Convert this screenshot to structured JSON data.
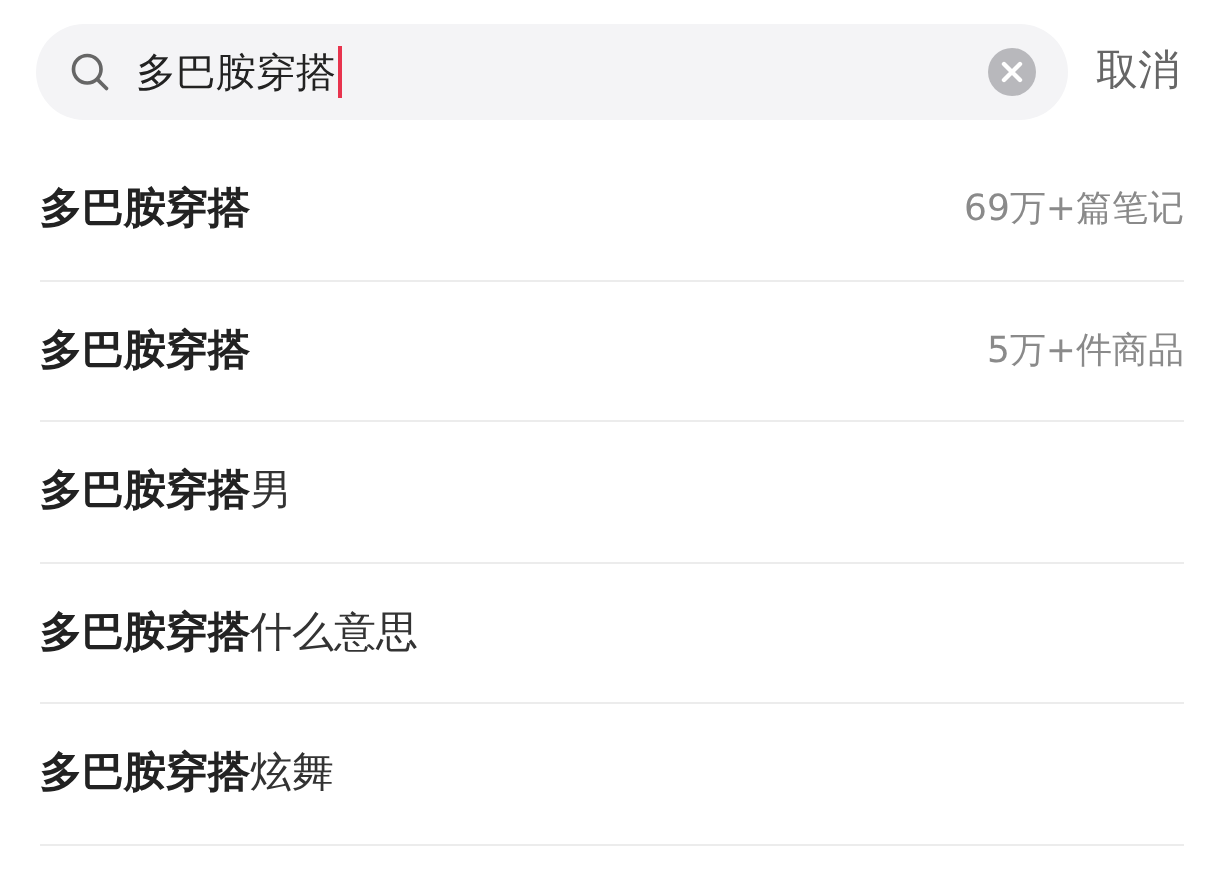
{
  "search": {
    "value": "多巴胺穿搭",
    "cancel": "取消"
  },
  "suggestions": [
    {
      "kind": "count",
      "text": "**多巴胺穿搭**",
      "count": "69万+篇笔记"
    },
    {
      "kind": "count",
      "text": "**多巴胺穿搭**",
      "count": "5万+件商品"
    },
    {
      "kind": "plain",
      "text": "**多巴胺穿搭**男"
    },
    {
      "kind": "plain",
      "text": "**多巴胺穿搭**什么意思"
    },
    {
      "kind": "plain",
      "text": "**多巴胺穿搭**炫舞"
    }
  ]
}
